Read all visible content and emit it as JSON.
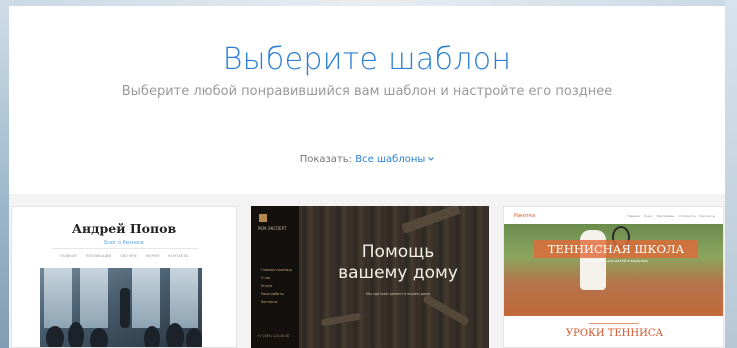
{
  "header": {
    "title": "Выберите шаблон",
    "subtitle": "Выберите любой понравившийся вам шаблон и настройте его позднее"
  },
  "filter": {
    "label": "Показать:",
    "value": "Все шаблоны",
    "chevron_icon": "chevron-down-icon"
  },
  "templates": [
    {
      "name": "Андрей Попов",
      "tagline": "Блог о бизнесе",
      "menu": [
        "ГЛАВНАЯ",
        "ПУБЛИКАЦИИ",
        "ОБО МНЕ",
        "ФОРУМ",
        "КОНТАКТЫ"
      ]
    },
    {
      "brand": "РЕМ ЭКСПЕРТ",
      "menu": [
        "Главная страница",
        "О нас",
        "Услуги",
        "Наши работы",
        "Контакты"
      ],
      "headline_line1": "Помощь",
      "headline_line2": "вашему дому",
      "sub": "Мы сделаем ремонт в вашем доме",
      "phone": "+7 (495) 123-45-67"
    },
    {
      "brand": "Ракетка",
      "menu": [
        "Главная",
        "О нас",
        "Программы",
        "Стоимость",
        "Контакты"
      ],
      "banner": "ТЕННИСНАЯ ШКОЛА",
      "banner_sub": "Тренировки для детей и взрослых",
      "section": "УРОКИ ТЕННИСА"
    }
  ],
  "colors": {
    "accent": "#2c7fd2",
    "subtle_text": "#9a9a9a",
    "tennis_orange": "#d2562b"
  }
}
